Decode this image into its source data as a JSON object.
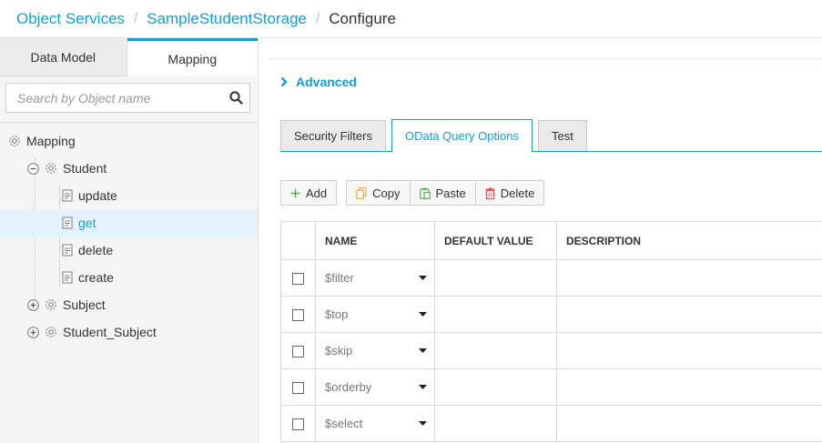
{
  "breadcrumb": {
    "items": [
      "Object Services",
      "SampleStudentStorage",
      "Configure"
    ],
    "separator": "/"
  },
  "left_tabs": [
    "Data Model",
    "Mapping"
  ],
  "search": {
    "placeholder": "Search by Object name"
  },
  "tree": {
    "root": "Mapping",
    "student": "Student",
    "student_children": [
      "update",
      "get",
      "delete",
      "create"
    ],
    "subject": "Subject",
    "student_subject": "Student_Subject",
    "selected": "get"
  },
  "advanced_label": "Advanced",
  "tabs": [
    "Security Filters",
    "OData Query Options",
    "Test"
  ],
  "active_tab": "OData Query Options",
  "toolbar": {
    "add": "Add",
    "copy": "Copy",
    "paste": "Paste",
    "delete": "Delete"
  },
  "table": {
    "headers": [
      "NAME",
      "DEFAULT VALUE",
      "DESCRIPTION"
    ],
    "rows": [
      {
        "name": "$filter",
        "default_value": "",
        "description": ""
      },
      {
        "name": "$top",
        "default_value": "",
        "description": ""
      },
      {
        "name": "$skip",
        "default_value": "",
        "description": ""
      },
      {
        "name": "$orderby",
        "default_value": "",
        "description": ""
      },
      {
        "name": "$select",
        "default_value": "",
        "description": ""
      }
    ]
  },
  "colors": {
    "accent": "#1a9bd0",
    "add_icon": "#4caf50",
    "copy_icon": "#f2a11c",
    "paste_icon": "#4caf50",
    "delete_icon": "#d9534f"
  }
}
